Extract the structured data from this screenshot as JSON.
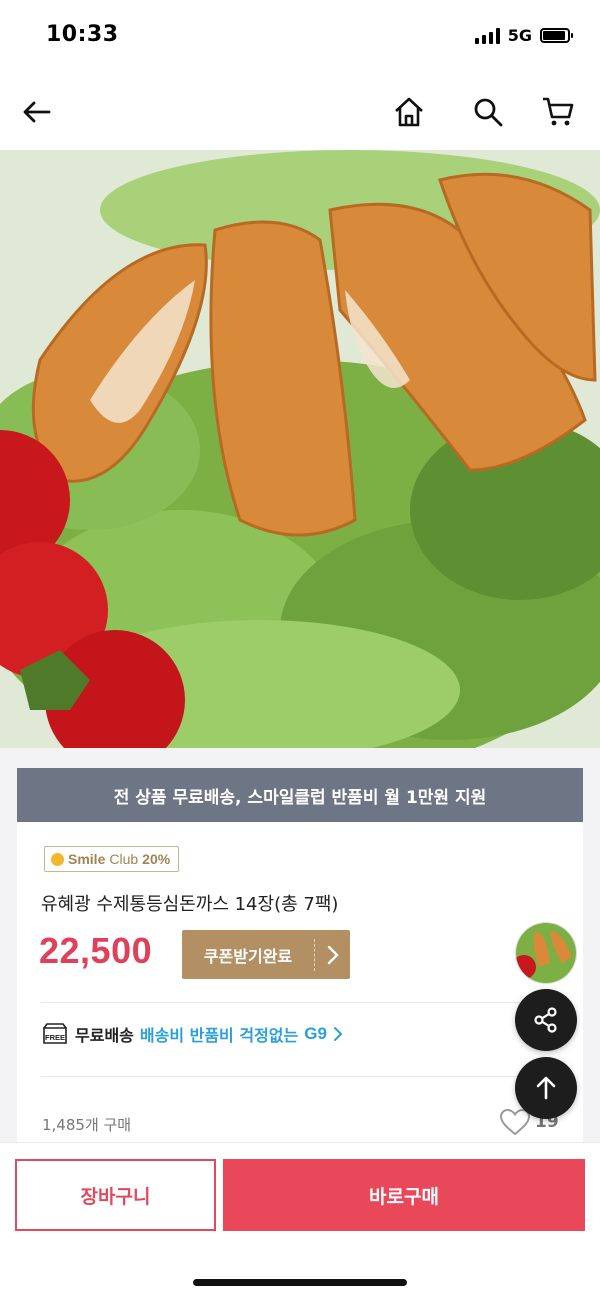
{
  "status_bar": {
    "time": "10:33",
    "network": "5G"
  },
  "nav": {
    "back_icon": "back-arrow-icon",
    "home_icon": "home-icon",
    "search_icon": "search-icon",
    "cart_icon": "cart-icon"
  },
  "banner": {
    "text": "전 상품 무료배송, 스마일클럽 반품비 월 1만원 지원"
  },
  "product": {
    "smile_club_brand": "Smile",
    "smile_club_club": "Club",
    "smile_club_rate": "20%",
    "title": "유혜광 수제통등심돈까스 14장(총 7팩)",
    "price": "22,500",
    "coupon_label": "쿠폰받기완료"
  },
  "shipping": {
    "free_badge": "FREE",
    "label": "무료배송",
    "promo": "배송비 반품비 걱정없는",
    "brand": "G9"
  },
  "stats": {
    "purchase_count": "1,485개 구매",
    "like_count": "19"
  },
  "floating": {
    "share_icon": "share-icon",
    "scroll_top_icon": "arrow-up-icon"
  },
  "bottom_bar": {
    "cart_button": "장바구니",
    "buy_button": "바로구매"
  },
  "colors": {
    "accent": "#e9475a",
    "banner": "#6e7584",
    "coupon": "#b39064",
    "link": "#2a9fdc"
  }
}
